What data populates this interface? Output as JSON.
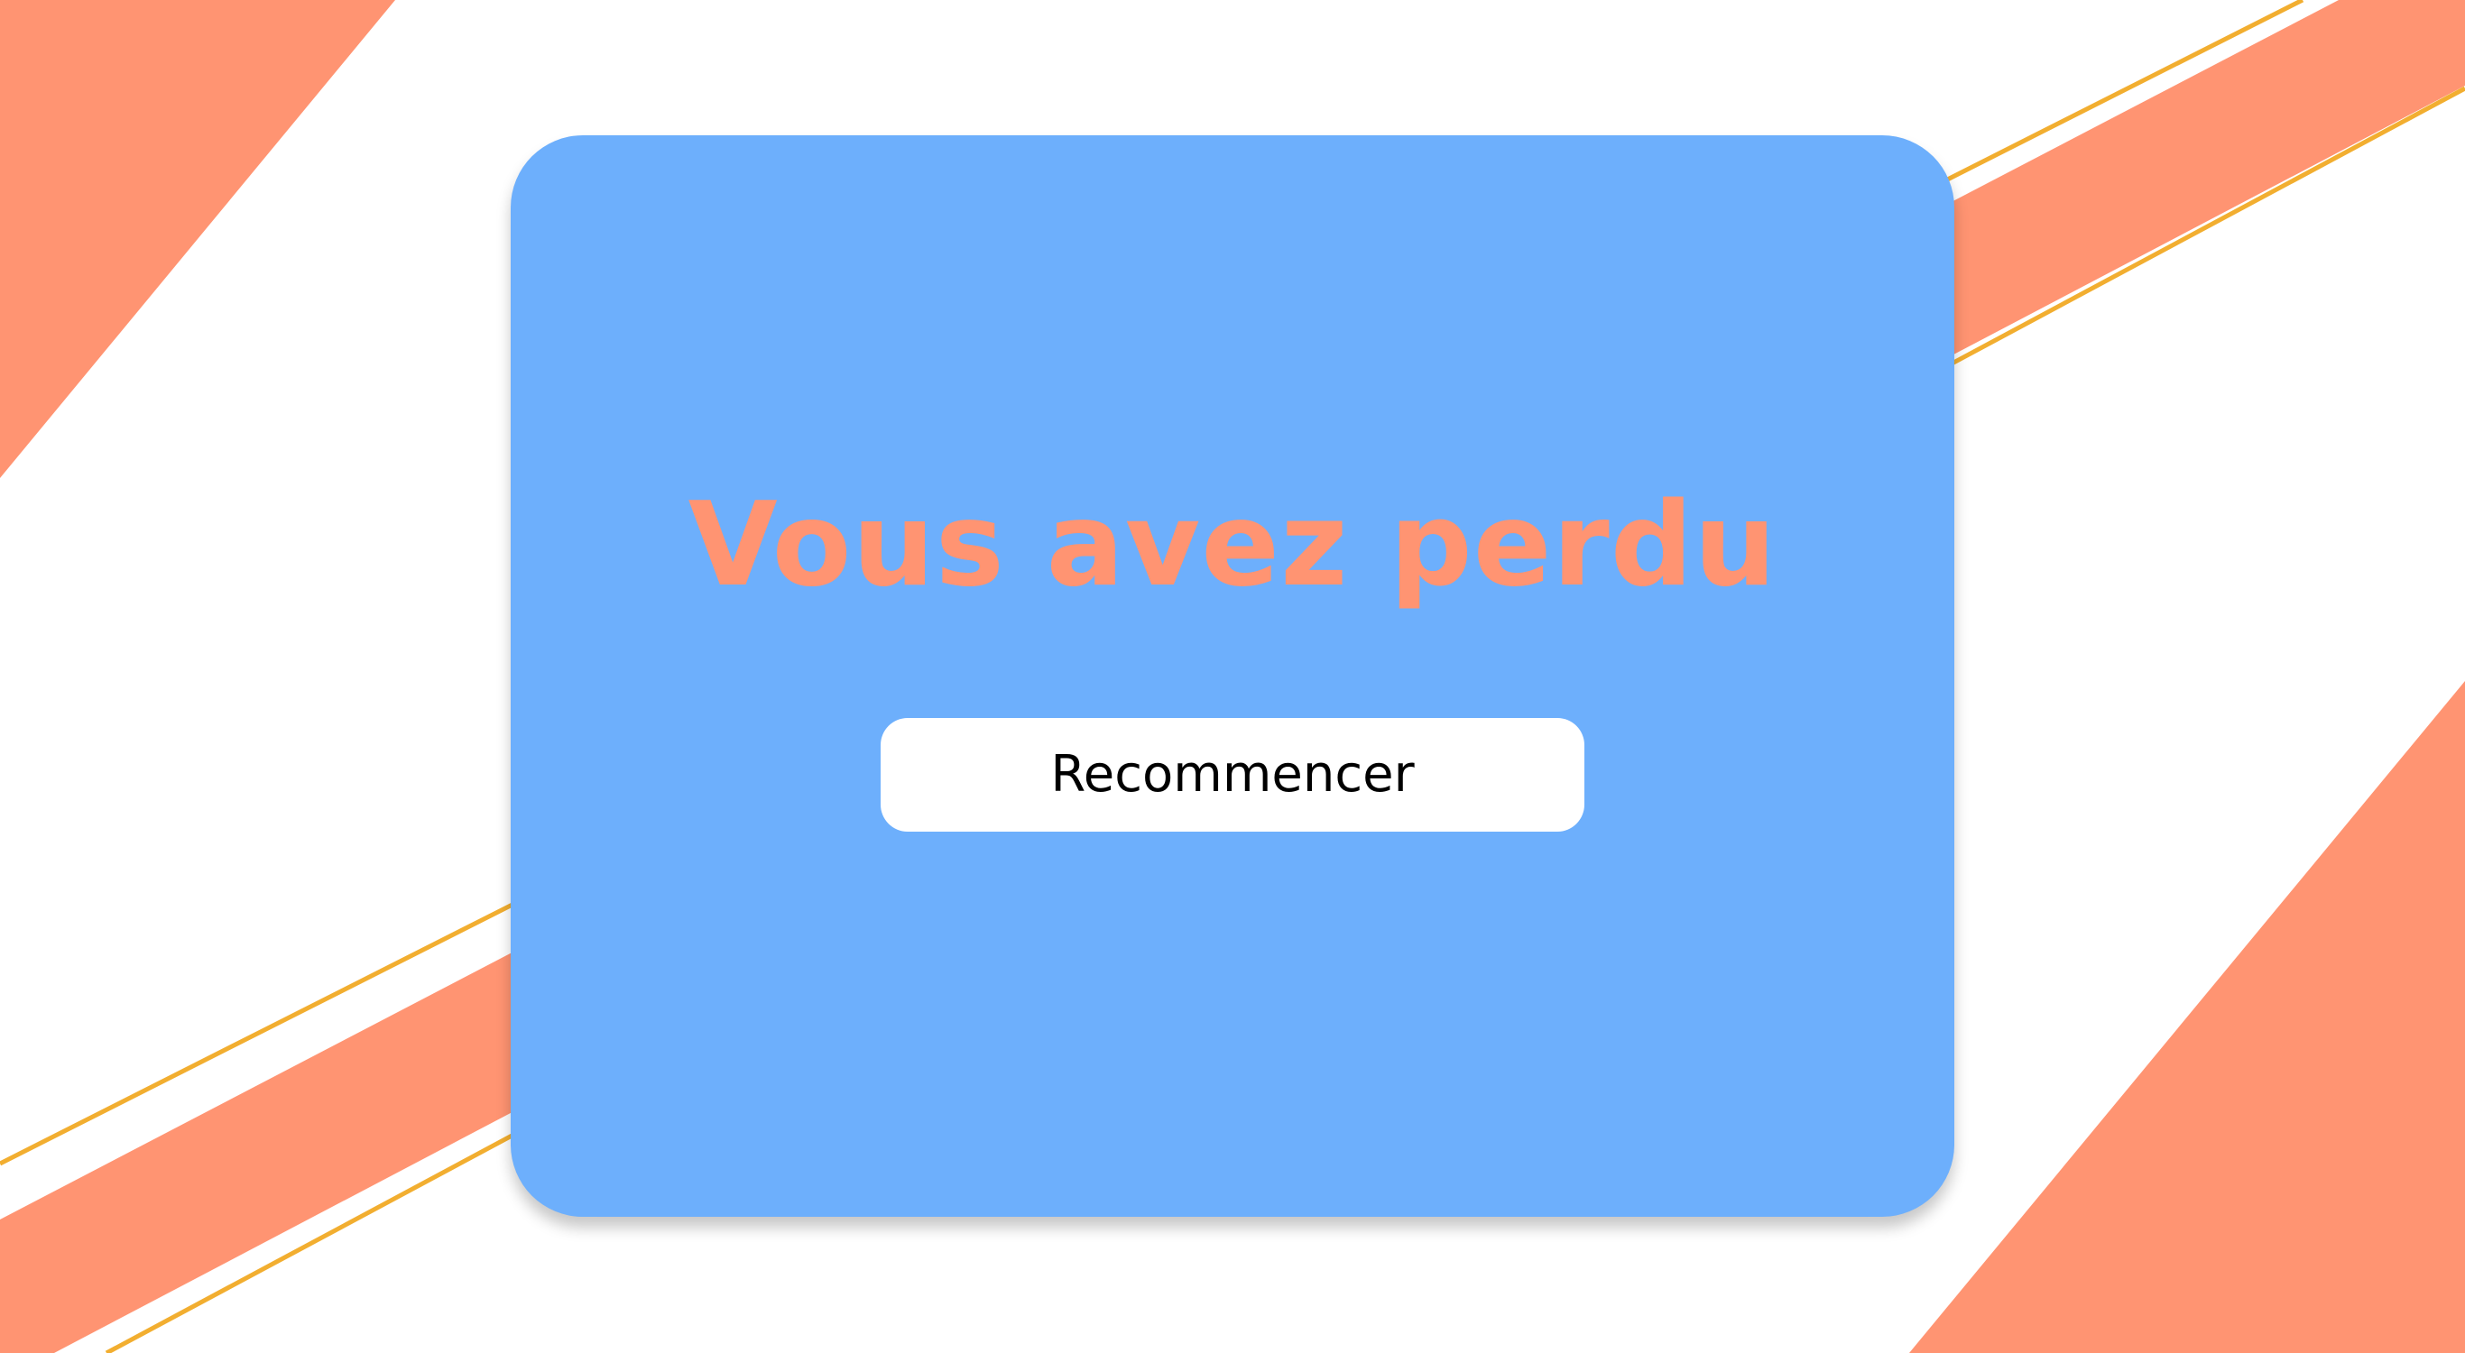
{
  "game_over": {
    "title": "Vous avez perdu",
    "restart_label": "Recommencer"
  },
  "colors": {
    "background": "#ffffff",
    "stripe": "#ff9472",
    "line": "#f2ae30",
    "card": "#6daffc",
    "title_text": "#ff9472",
    "button_background": "#ffffff",
    "button_text": "#000000"
  }
}
